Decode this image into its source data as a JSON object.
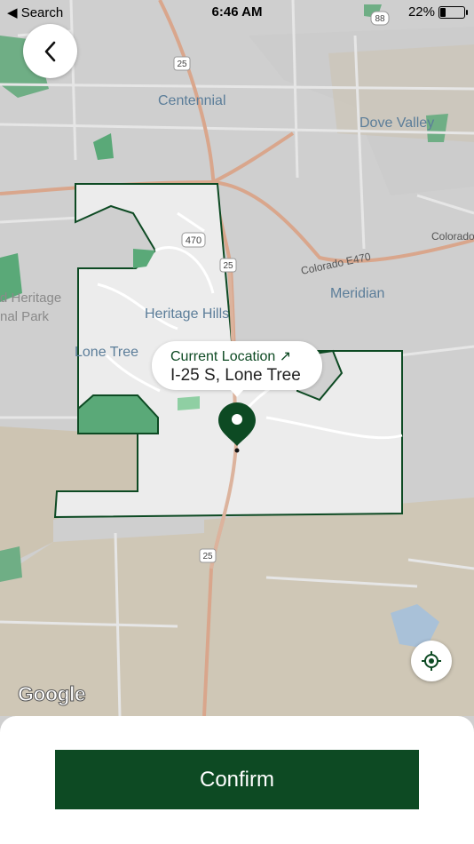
{
  "status_bar": {
    "back_app": "◀ Search",
    "time": "6:46 AM",
    "battery": "22%"
  },
  "tooltip": {
    "title": "Current Location ↗",
    "subtitle": "I-25 S, Lone Tree"
  },
  "map_labels": {
    "centennial": "Centennial",
    "dove_valley": "Dove Valley",
    "heritage_hills": "Heritage Hills",
    "lone_tree": "Lone Tree",
    "meridian": "Meridian",
    "heritage_park_1": "d Heritage",
    "heritage_park_2": "nal Park",
    "colorado_e470": "Colorado E470",
    "colorado": "Colorado",
    "shield_470": "470",
    "shield_25_top": "25",
    "shield_25_mid": "25",
    "shield_25_bottom": "25",
    "shield_88": "88"
  },
  "colors": {
    "brand_green": "#0d4a23",
    "zone_fill": "#ececec",
    "map_bg": "#cfcfcf"
  },
  "attribution": "Google",
  "bottom_sheet": {
    "confirm_label": "Confirm"
  }
}
